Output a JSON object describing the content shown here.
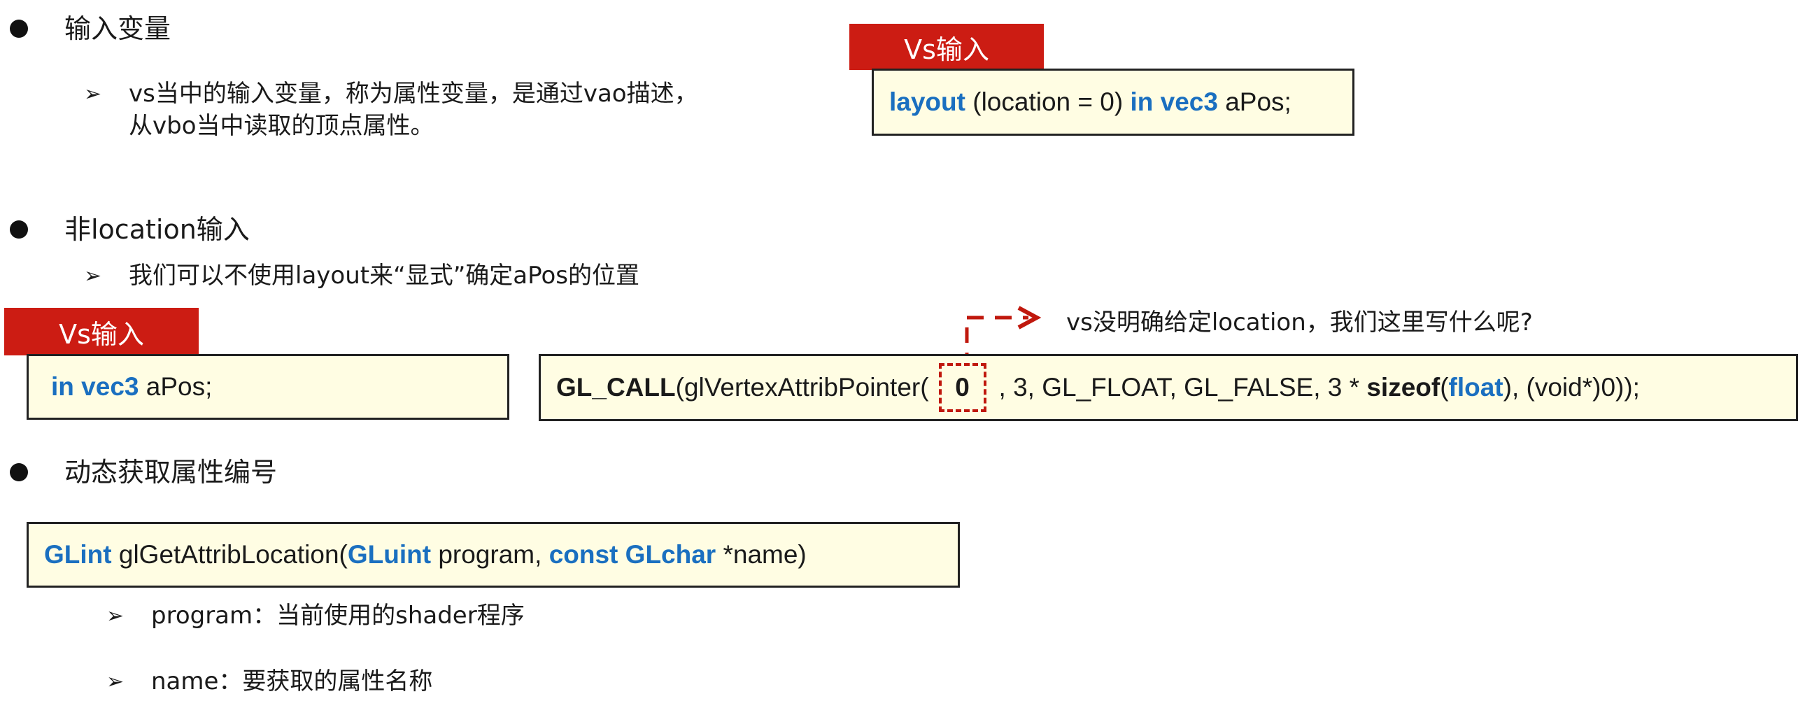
{
  "section1": {
    "heading": "输入变量",
    "sub_line1": "vs当中的输入变量，称为属性变量，是通过vao描述，",
    "sub_line2": "从vbo当中读取的顶点属性。",
    "tab_label": "Vs输入",
    "code": {
      "layout_kw": "layout",
      "location_part": " (location = 0) ",
      "in_vec3_kw": "in vec3",
      "var": " aPos;"
    }
  },
  "section2": {
    "heading": "非location输入",
    "sub_line": "我们可以不使用layout来“显式”确定aPos的位置",
    "tab_label": "Vs输入",
    "code_left": {
      "in_vec3_kw": "in vec3",
      "var": " aPos;"
    },
    "annotation": "vs没明确给定location，我们这里写什么呢?",
    "code_right": {
      "glcall": "GL_CALL",
      "func_open": "(glVertexAttribPointer(",
      "zero": "0",
      "args": ", 3, GL_FLOAT, GL_FALSE, 3 * ",
      "sizeof_kw": "sizeof",
      "paren_open": "(",
      "float_kw": "float",
      "tail": "), (void*)0));"
    }
  },
  "section3": {
    "heading": "动态获取属性编号",
    "code": {
      "glint_kw": "GLint",
      "func": " glGetAttribLocation(",
      "gluint_kw": "GLuint",
      "program_arg": " program, ",
      "const_glchar_kw": "const GLchar",
      "name_arg": " *name)"
    },
    "item1": "program：当前使用的shader程序",
    "item2": "name：要获取的属性名称"
  },
  "colors": {
    "accent_red": "#cc1c13",
    "keyword_blue": "#1a6fc0",
    "code_bg": "#fffde3"
  }
}
